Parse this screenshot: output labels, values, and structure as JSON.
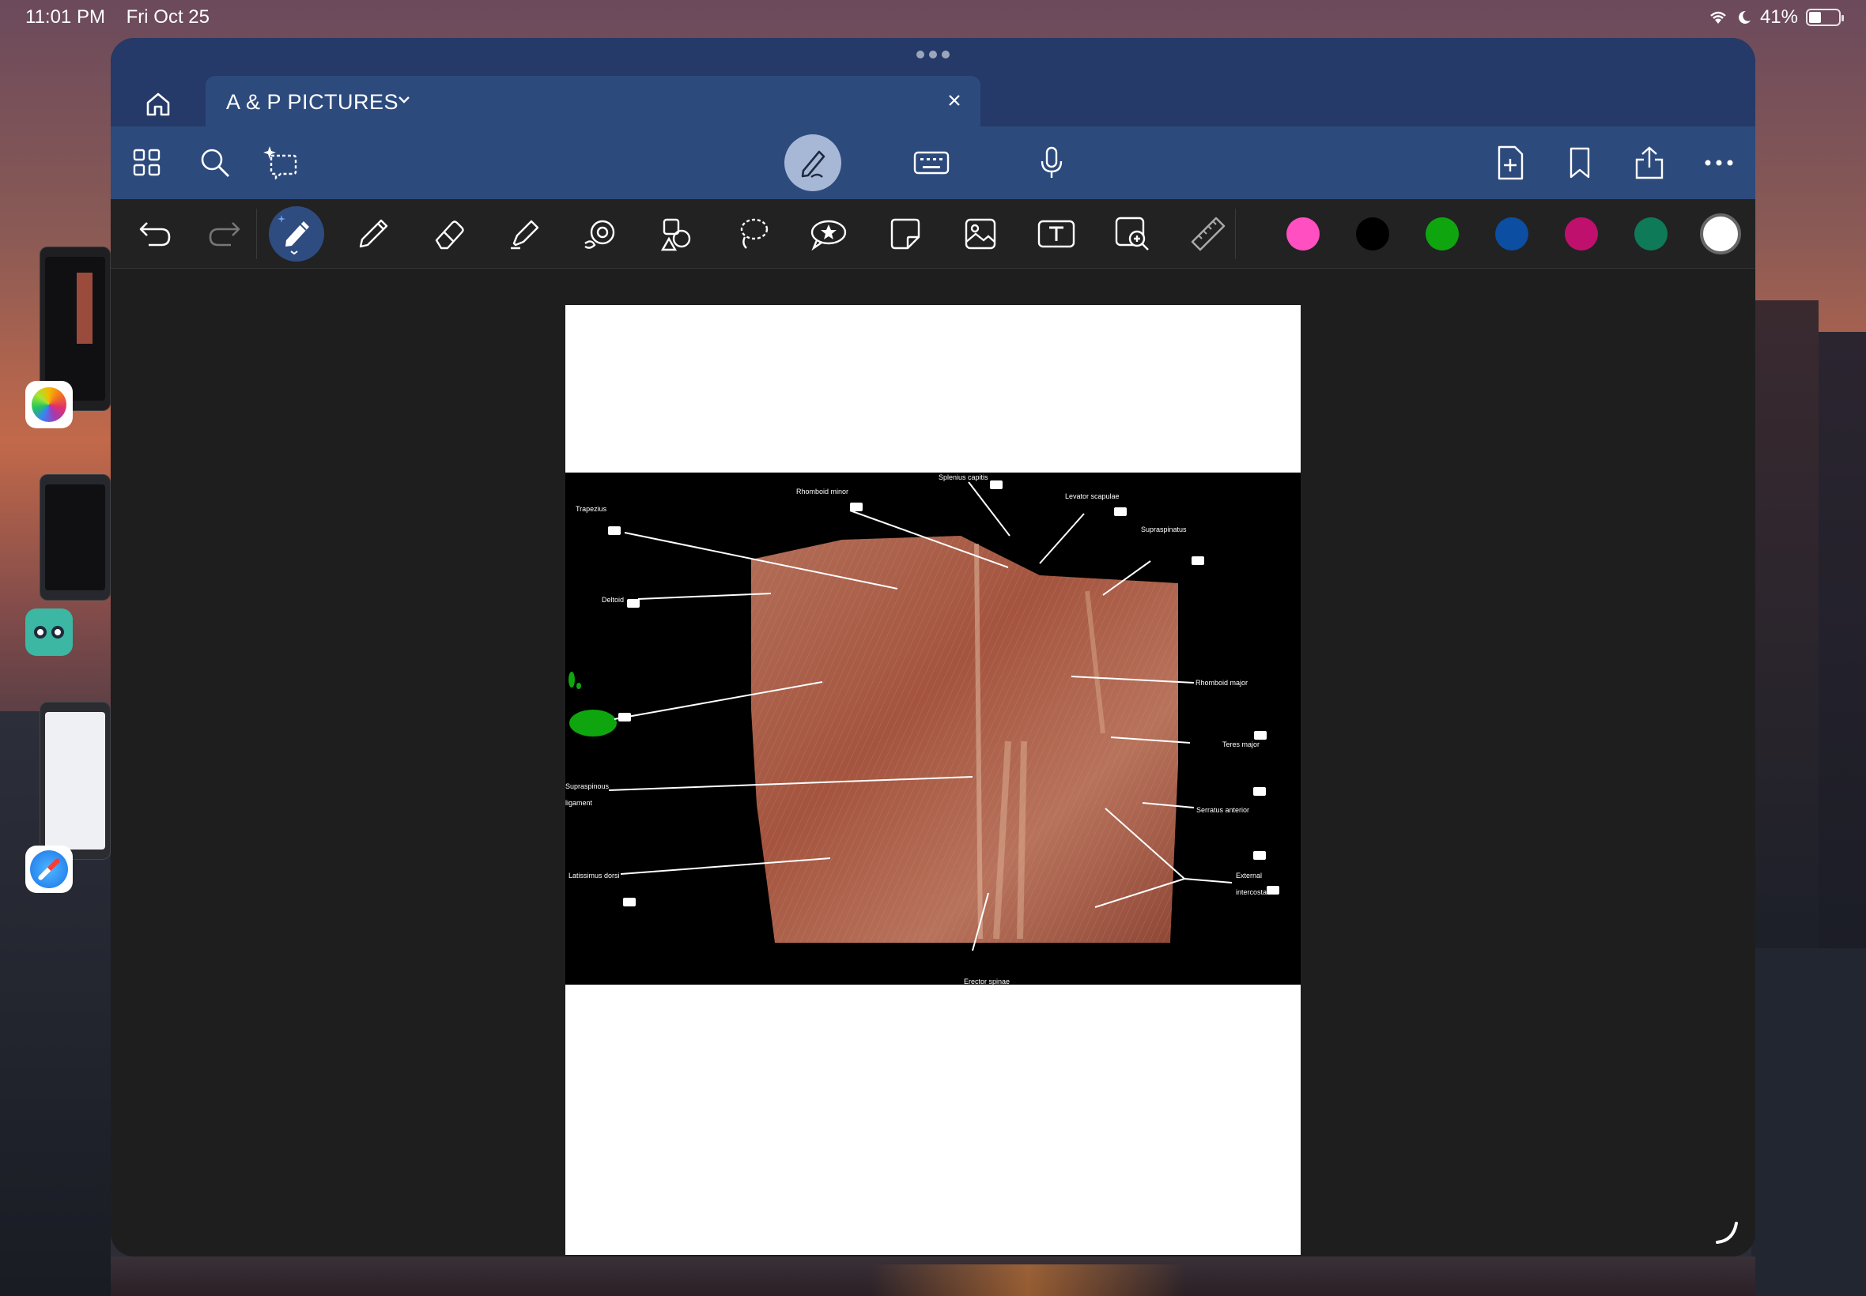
{
  "status_bar": {
    "time": "11:01 PM",
    "date": "Fri Oct 25",
    "battery": "41%",
    "battery_level": 0.41
  },
  "tab": {
    "title": "A & P PICTURES"
  },
  "toolbar_top": {
    "left_icons": [
      "grid-icon",
      "search-icon",
      "ai-sparkle-lasso-icon"
    ],
    "center_icons": [
      "pen-mode-icon",
      "keyboard-icon",
      "microphone-icon"
    ],
    "right_icons": [
      "add-page-icon",
      "bookmark-icon",
      "share-icon",
      "more-icon"
    ]
  },
  "toolbar_tools": {
    "tools": [
      "undo-icon",
      "redo-icon",
      "pen-tool-icon",
      "pencil-icon",
      "eraser-icon",
      "highlighter-icon",
      "shape-icon",
      "shapes-icon",
      "lasso-icon",
      "sticker-icon",
      "sticky-note-icon",
      "image-icon",
      "text-box-icon",
      "zoom-image-icon",
      "ruler-icon"
    ],
    "colors": [
      "#ff4fc0",
      "#000000",
      "#0fa50f",
      "#0b4ea2",
      "#c0106e",
      "#0e7a57",
      "#ffffff"
    ]
  },
  "figure": {
    "labels": {
      "splenius": "Splenius capitis",
      "rhomboid_minor": "Rhomboid minor",
      "levator": "Levator scapulae",
      "trapezius": "Trapezius",
      "supraspinatus": "Supraspinatus",
      "deltoid": "Deltoid",
      "rhomboid_major": "Rhomboid major",
      "teres_major": "Teres major",
      "supraspinous_1": "Supraspinous",
      "supraspinous_2": "ligament",
      "serratus": "Serratus anterior",
      "latissimus": "Latissimus dorsi",
      "external": "External",
      "intercostals": "intercostals",
      "erector": "Erector spinae"
    }
  }
}
